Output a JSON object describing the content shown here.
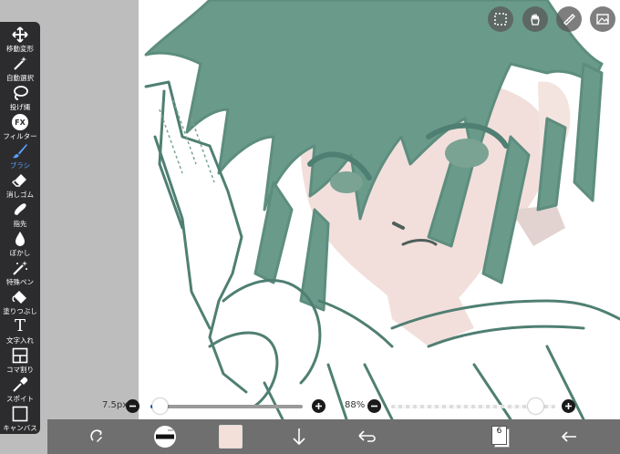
{
  "toolbar": {
    "tools": [
      {
        "label": "移動変形",
        "icon": "move-icon"
      },
      {
        "label": "自動選択",
        "icon": "magic-wand-icon"
      },
      {
        "label": "投げ縄",
        "icon": "lasso-icon"
      },
      {
        "label": "フィルター",
        "icon": "fx-icon",
        "glyph": "FX"
      },
      {
        "label": "ブラシ",
        "icon": "brush-icon",
        "active": true
      },
      {
        "label": "消しゴム",
        "icon": "eraser-icon"
      },
      {
        "label": "指先",
        "icon": "finger-icon"
      },
      {
        "label": "ぼかし",
        "icon": "blur-drop-icon"
      },
      {
        "label": "特殊ペン",
        "icon": "special-pen-icon"
      },
      {
        "label": "塗りつぶし",
        "icon": "fill-bucket-icon"
      },
      {
        "label": "文字入れ",
        "icon": "text-icon",
        "glyph": "T"
      },
      {
        "label": "コマ割り",
        "icon": "frame-divider-icon"
      },
      {
        "label": "スポイト",
        "icon": "eyedropper-icon"
      },
      {
        "label": "キャンバス",
        "icon": "canvas-icon"
      }
    ],
    "active_color": "#5aa2ff"
  },
  "top_buttons": [
    {
      "name": "selection-button",
      "icon": "dashed-selection-icon"
    },
    {
      "name": "hand-button",
      "icon": "hand-icon"
    },
    {
      "name": "ruler-button",
      "icon": "ruler-icon"
    },
    {
      "name": "material-button",
      "icon": "material-image-icon"
    }
  ],
  "sliders": {
    "brush_size": {
      "label": "7.5px",
      "fraction": 0.06
    },
    "opacity": {
      "label": "88%",
      "fraction": 0.88
    }
  },
  "bottom_bar": {
    "layer_count": "6",
    "color_swatch": "#f3e0d8",
    "icons": [
      "rotate-icon",
      "brush-preview-icon",
      "color-swatch",
      "down-arrow-icon",
      "undo-icon",
      "layers-icon",
      "back-arrow-icon"
    ]
  },
  "colors": {
    "hair": "#6a9a8a",
    "skin": "#f2dfdc",
    "outline": "#4f7f72",
    "panel": "#2c2c2e"
  }
}
